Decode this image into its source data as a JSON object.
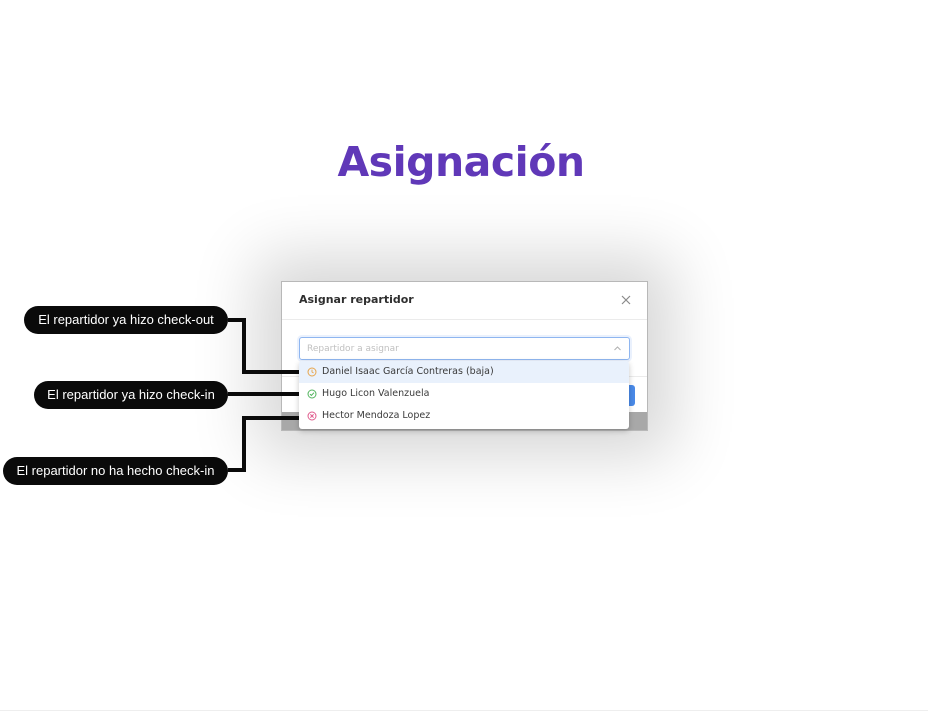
{
  "page": {
    "title": "Asignación"
  },
  "modal": {
    "title": "Asignar repartidor",
    "close_icon": "close-icon",
    "input": {
      "value": "",
      "placeholder": "Repartidor a asignar"
    }
  },
  "dropdown": {
    "options": [
      {
        "label": "Daniel Isaac García Contreras (baja)",
        "status_icon": "clock-icon",
        "color": "#e8a54a",
        "highlighted": true
      },
      {
        "label": "Hugo Licon Valenzuela",
        "status_icon": "check-circle-icon",
        "color": "#52b45e",
        "highlighted": false
      },
      {
        "label": "Hector Mendoza Lopez",
        "status_icon": "x-circle-icon",
        "color": "#e05a8c",
        "highlighted": false
      }
    ]
  },
  "callouts": {
    "checkout": "El repartidor ya hizo check-out",
    "checkin": "El repartidor ya hizo check-in",
    "no_checkin": "El repartidor no ha hecho check-in"
  },
  "colors": {
    "title": "#6038b8",
    "primary_button": "#4a8ae8",
    "callout_bg": "#0a0a0a"
  }
}
